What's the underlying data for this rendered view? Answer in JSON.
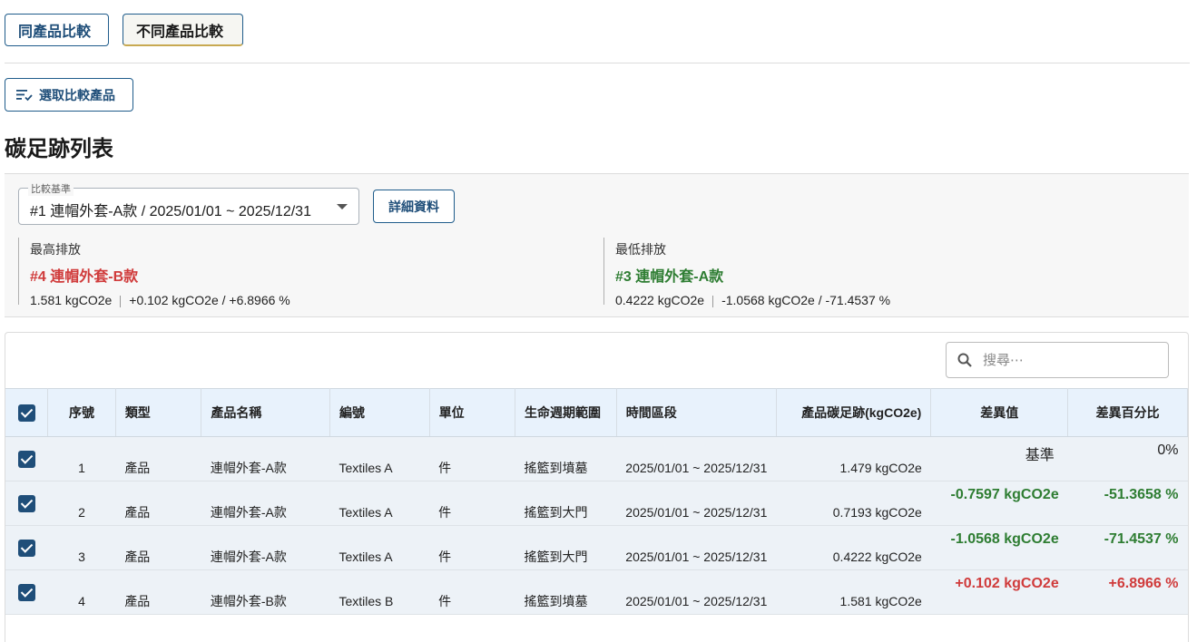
{
  "tabs": [
    {
      "label": "同產品比較",
      "active": false
    },
    {
      "label": "不同產品比較",
      "active": true
    }
  ],
  "select_button": {
    "label": "選取比較產品",
    "icon": "sort-list-icon"
  },
  "page_title": "碳足跡列表",
  "comparison": {
    "baseline_label": "比較基準",
    "baseline_value": "#1 連帽外套-A款 / 2025/01/01 ~ 2025/12/31",
    "detail_button": "詳細資料",
    "highest": {
      "heading": "最高排放",
      "name": "#4 連帽外套-B款",
      "value": "1.581 kgCO2e",
      "diff": "+0.102 kgCO2e / +6.8966 %"
    },
    "lowest": {
      "heading": "最低排放",
      "name": "#3 連帽外套-A款",
      "value": "0.4222 kgCO2e",
      "diff": "-1.0568 kgCO2e / -71.4537 %"
    }
  },
  "search": {
    "placeholder": "搜尋⋯"
  },
  "table": {
    "headers": {
      "seq": "序號",
      "type": "類型",
      "name": "產品名稱",
      "code": "編號",
      "unit": "單位",
      "lifecycle": "生命週期範圍",
      "period": "時間區段",
      "footprint": "產品碳足跡(kgCO2e)",
      "diff": "差異值",
      "pct": "差異百分比"
    },
    "rows": [
      {
        "seq": "1",
        "type": "產品",
        "name": "連帽外套-A款",
        "code": "Textiles A",
        "unit": "件",
        "lifecycle": "搖籃到墳墓",
        "period": "2025/01/01 ~ 2025/12/31",
        "footprint": "1.479 kgCO2e",
        "diff": "基準",
        "pct": "0%"
      },
      {
        "seq": "2",
        "type": "產品",
        "name": "連帽外套-A款",
        "code": "Textiles A",
        "unit": "件",
        "lifecycle": "搖籃到大門",
        "period": "2025/01/01 ~ 2025/12/31",
        "footprint": "0.7193 kgCO2e",
        "diff": "-0.7597 kgCO2e",
        "pct": "-51.3658 %"
      },
      {
        "seq": "3",
        "type": "產品",
        "name": "連帽外套-A款",
        "code": "Textiles A",
        "unit": "件",
        "lifecycle": "搖籃到大門",
        "period": "2025/01/01 ~ 2025/12/31",
        "footprint": "0.4222 kgCO2e",
        "diff": "-1.0568 kgCO2e",
        "pct": "-71.4537 %"
      },
      {
        "seq": "4",
        "type": "產品",
        "name": "連帽外套-B款",
        "code": "Textiles B",
        "unit": "件",
        "lifecycle": "搖籃到墳墓",
        "period": "2025/01/01 ~ 2025/12/31",
        "footprint": "1.581 kgCO2e",
        "diff": "+0.102 kgCO2e",
        "pct": "+6.8966 %"
      }
    ]
  },
  "colors": {
    "primary": "#1f4e79",
    "positive": "#d03b3b",
    "negative": "#2e7d32",
    "header_bg": "#e8f2fc"
  }
}
